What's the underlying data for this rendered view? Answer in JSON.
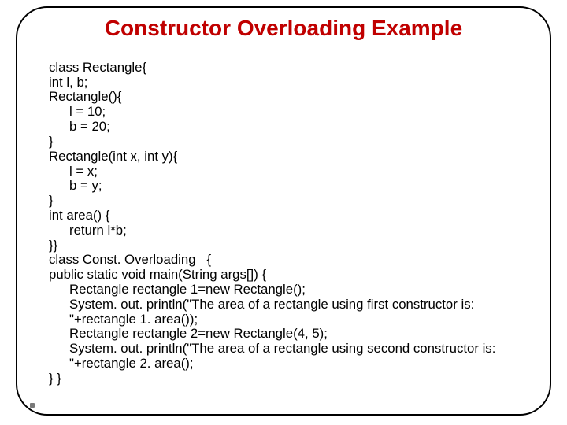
{
  "title": "Constructor Overloading Example",
  "code": {
    "l1": "class Rectangle{",
    "l2": "int l, b;",
    "l3": "Rectangle(){",
    "l4": "l = 10;",
    "l5": "b = 20;",
    "l6": "}",
    "l7": "Rectangle(int x, int y){",
    "l8": "l = x;",
    "l9": "b = y;",
    "l10": "}",
    "l11": "int area() {",
    "l12": "return l*b;",
    "l13": "}}",
    "l14": "class Const. Overloading   {",
    "l15": "public static void main(String args[]) {",
    "l16": "Rectangle rectangle 1=new Rectangle();",
    "l17": "System. out. println(\"The area of a rectangle using first constructor is:      \"+rectangle 1. area());",
    "l18": "Rectangle rectangle 2=new Rectangle(4, 5);",
    "l19": "System. out. println(\"The area of a rectangle using second constructor is:            \"+rectangle 2. area();",
    "l20": "} }"
  }
}
